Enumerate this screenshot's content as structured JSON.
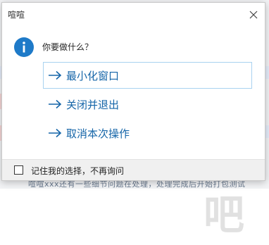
{
  "dialog": {
    "title": "喧喧",
    "prompt": "你要做什么？",
    "options": [
      {
        "label": "最小化窗口"
      },
      {
        "label": "关闭并退出"
      },
      {
        "label": "取消本次操作"
      }
    ],
    "remember_label": "记住我的选择，不再询问"
  },
  "background": {
    "bottom_text": "喧喧xxx还有一些细节问题在处理，处理完成后开始打包测试"
  },
  "colors": {
    "accent": "#1565a8",
    "info_icon": "#1e7ac8",
    "selected_border": "#a9d2f0"
  },
  "icons": {
    "close": "close-icon",
    "info": "info-icon",
    "arrow": "arrow-right-icon"
  }
}
